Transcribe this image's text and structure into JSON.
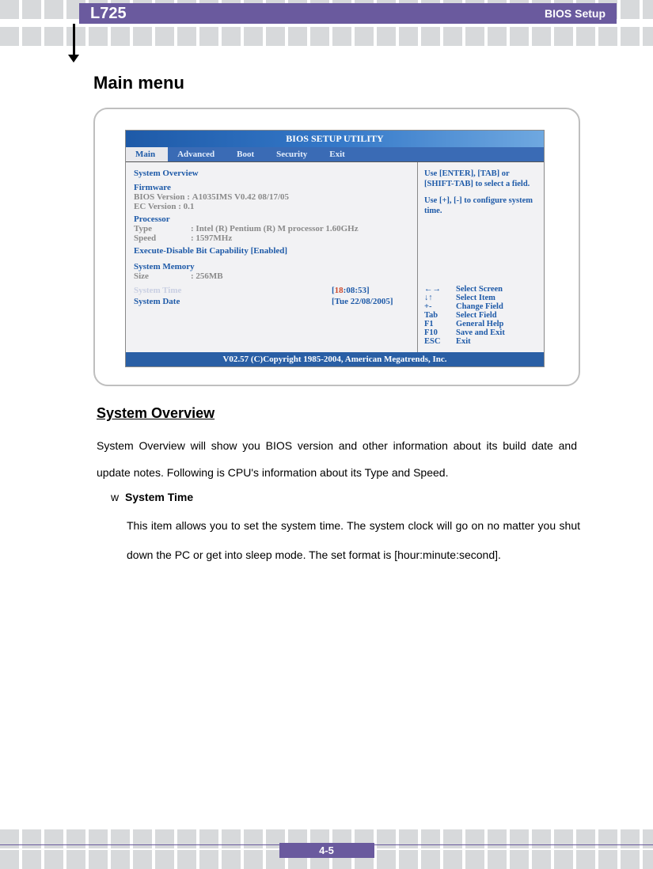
{
  "header": {
    "model": "L725",
    "section": "BIOS Setup"
  },
  "page_number": "4-5",
  "doc": {
    "main_title": "Main menu",
    "system_overview_heading": "System Overview",
    "system_overview_text": "System Overview will show you BIOS version and other information about its build date and update notes. Following is CPU's information about its Type and Speed.",
    "item_bullet": "w",
    "item_name": "System Time",
    "item_text": "This item allows you to set the system time.   The system clock will go on no matter you shut down the PC or get into sleep mode.   The set format is [hour:minute:second]."
  },
  "bios": {
    "title": "BIOS SETUP UTILITY",
    "tabs": [
      "Main",
      "Advanced",
      "Boot",
      "Security",
      "Exit"
    ],
    "active_tab": "Main",
    "left": {
      "overview": "System Overview",
      "firmware_hdr": "Firmware",
      "bios_ver_label": "BIOS Version :",
      "bios_ver_value": "A1035IMS V0.42 08/17/05",
      "ec_ver_label": "EC    Version :",
      "ec_ver_value": "0.1",
      "proc_hdr": "Processor",
      "type_label": "Type",
      "type_value": ":  Intel (R) Pentium (R) M processor 1.60GHz",
      "speed_label": "Speed",
      "speed_value": ":  1597MHz",
      "exec_disable": "Execute-Disable Bit Capability  [Enabled]",
      "mem_hdr": "System Memory",
      "size_label": "Size",
      "size_value": ":  256MB",
      "sys_time_label": "System Time",
      "sys_time_hour": "18",
      "sys_time_rest": ":08:53]",
      "sys_date_label": "System Date",
      "sys_date_value": "[Tue 22/08/2005]"
    },
    "right": {
      "hint1": "Use [ENTER], [TAB] or [SHIFT-TAB] to select a field.",
      "hint2": "Use [+], [-] to configure system time.",
      "keys": [
        {
          "k": "←→",
          "v": "Select Screen"
        },
        {
          "k": "↓↑",
          "v": "Select Item"
        },
        {
          "k": "+-",
          "v": "Change Field"
        },
        {
          "k": "Tab",
          "v": "Select Field"
        },
        {
          "k": "F1",
          "v": "General Help"
        },
        {
          "k": "F10",
          "v": "Save and Exit"
        },
        {
          "k": "ESC",
          "v": "Exit"
        }
      ]
    },
    "footer": "V02.57 (C)Copyright 1985-2004, American Megatrends, Inc."
  }
}
